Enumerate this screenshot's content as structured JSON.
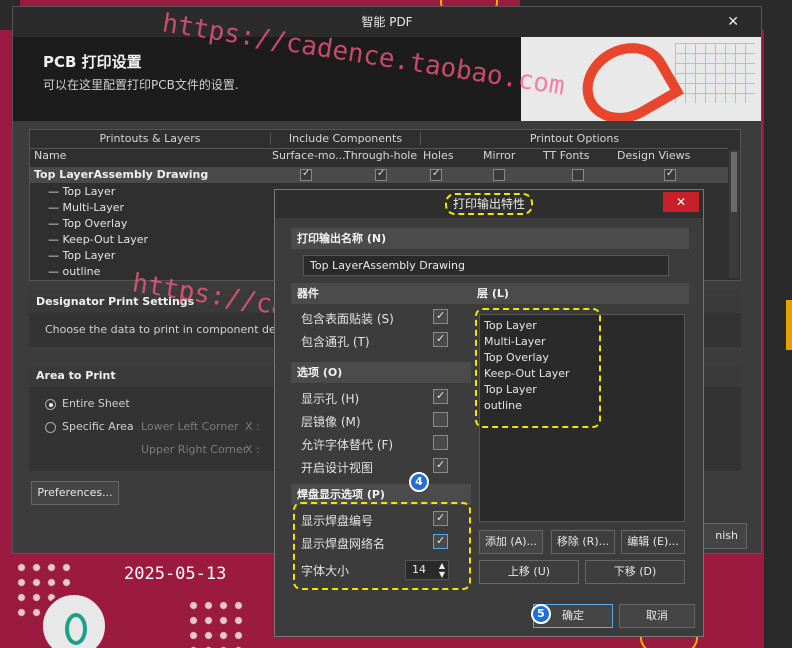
{
  "background": {
    "date_label": "2025-05-13",
    "pad_label": "0"
  },
  "watermark": "https://cadence.taobao.com",
  "main_dialog": {
    "title": "智能 PDF",
    "close_label": "✕",
    "banner_title": "PCB 打印设置",
    "banner_subtitle": "可以在这里配置打印PCB文件的设置.",
    "table": {
      "group_headers": [
        "Printouts & Layers",
        "Include Components",
        "Printout Options"
      ],
      "columns": [
        "Name",
        "Surface-mo...",
        "Through-hole",
        "Holes",
        "Mirror",
        "TT Fonts",
        "Design Views"
      ],
      "root": {
        "name": "Top LayerAssembly Drawing",
        "checks": [
          true,
          true,
          true,
          false,
          false,
          true
        ]
      },
      "layers": [
        "Top Layer",
        "Multi-Layer",
        "Top Overlay",
        "Keep-Out Layer",
        "Top Layer",
        "outline"
      ]
    },
    "designator": {
      "title": "Designator Print Settings",
      "text": "Choose the data to print in component desi"
    },
    "area": {
      "title": "Area to Print",
      "entire_sheet": "Entire Sheet",
      "specific_area": "Specific Area",
      "lower_left": "Lower Left Corner",
      "upper_right": "Upper Right Corner",
      "x_label": "X :"
    },
    "preferences_button": "Preferences...",
    "finish_button": "nish"
  },
  "props_dialog": {
    "title": "打印输出特性",
    "close_label": "✕",
    "name_section": "打印输出名称 (N)",
    "name_value": "Top LayerAssembly Drawing",
    "components_section": "器件",
    "include_smd": "包含表面贴装 (S)",
    "include_th": "包含通孔 (T)",
    "options_section": "选项 (O)",
    "show_holes": "显示孔 (H)",
    "mirror_layers": "层镜像 (M)",
    "allow_font_sub": "允许字体替代 (F)",
    "open_design_view": "开启设计视图",
    "pad_section": "焊盘显示选项 (P)",
    "show_pad_numbers": "显示焊盘编号",
    "show_pad_nets": "显示焊盘网络名",
    "font_size_label": "字体大小",
    "font_size_value": "14",
    "layers_section": "层 (L)",
    "layers": [
      "Top Layer",
      "Multi-Layer",
      "Top Overlay",
      "Keep-Out Layer",
      "Top Layer",
      "outline"
    ],
    "buttons": {
      "add": "添加 (A)...",
      "remove": "移除 (R)...",
      "edit": "编辑 (E)...",
      "up": "上移 (U)",
      "down": "下移 (D)"
    },
    "ok_button": "确定",
    "cancel_button": "取消",
    "checks": {
      "smd": true,
      "th": true,
      "holes": true,
      "mirror": false,
      "font_sub": false,
      "design_view": true,
      "pad_numbers": true,
      "pad_nets": true
    }
  },
  "markers": {
    "four": "4",
    "five": "5"
  }
}
